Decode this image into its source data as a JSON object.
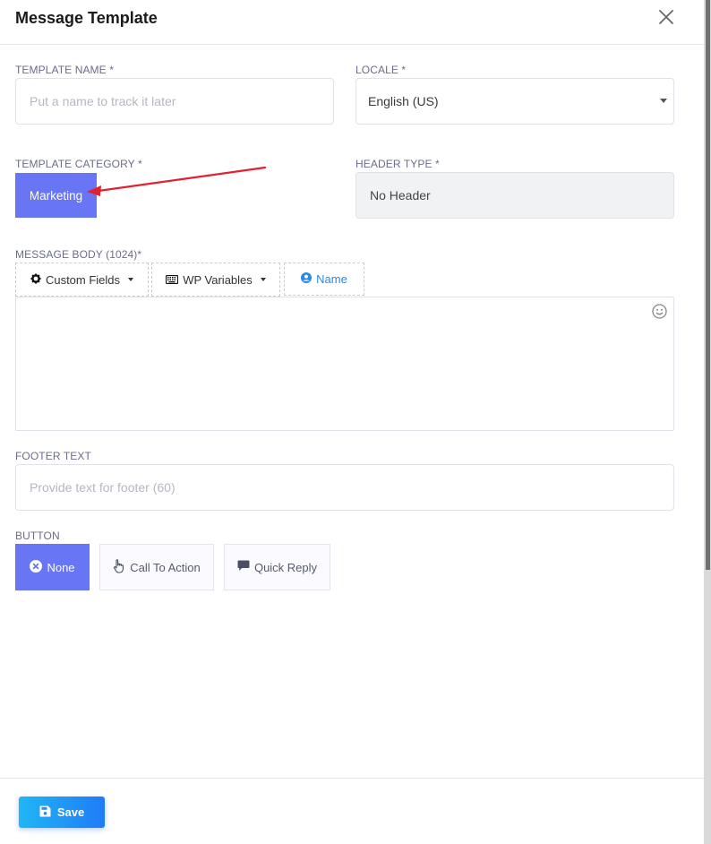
{
  "modal": {
    "title": "Message Template"
  },
  "template_name": {
    "label": "TEMPLATE NAME *",
    "placeholder": "Put a name to track it later",
    "value": ""
  },
  "locale": {
    "label": "LOCALE *",
    "selected": "English (US)"
  },
  "template_category": {
    "label": "TEMPLATE CATEGORY *",
    "selected": "Marketing"
  },
  "header_type": {
    "label": "HEADER TYPE *",
    "value": "No Header"
  },
  "message_body": {
    "label": "MESSAGE BODY (1024)*",
    "toolbar": {
      "custom_fields": "Custom Fields",
      "wp_variables": "WP Variables",
      "name": "Name"
    },
    "value": ""
  },
  "footer_text": {
    "label": "FOOTER TEXT",
    "placeholder": "Provide text for footer (60)",
    "value": ""
  },
  "button": {
    "label": "BUTTON",
    "options": [
      "None",
      "Call To Action",
      "Quick Reply"
    ],
    "selected": "None"
  },
  "actions": {
    "save_label": "Save"
  },
  "colors": {
    "accent": "#6875f5",
    "save_gradient_start": "#20b6f4",
    "save_gradient_end": "#1f7cf7",
    "annotation_arrow": "#e3202b",
    "link_blue": "#2b8ae2"
  },
  "icons": {
    "close": "close-icon",
    "custom_fields": "gear-icon",
    "wp_variables": "keyboard-icon",
    "name": "user-circle-icon",
    "emoji": "smiley-icon",
    "none": "x-circle-icon",
    "call_to_action": "pointer-hand-icon",
    "quick_reply": "chat-bubble-icon",
    "save": "floppy-disk-icon"
  }
}
